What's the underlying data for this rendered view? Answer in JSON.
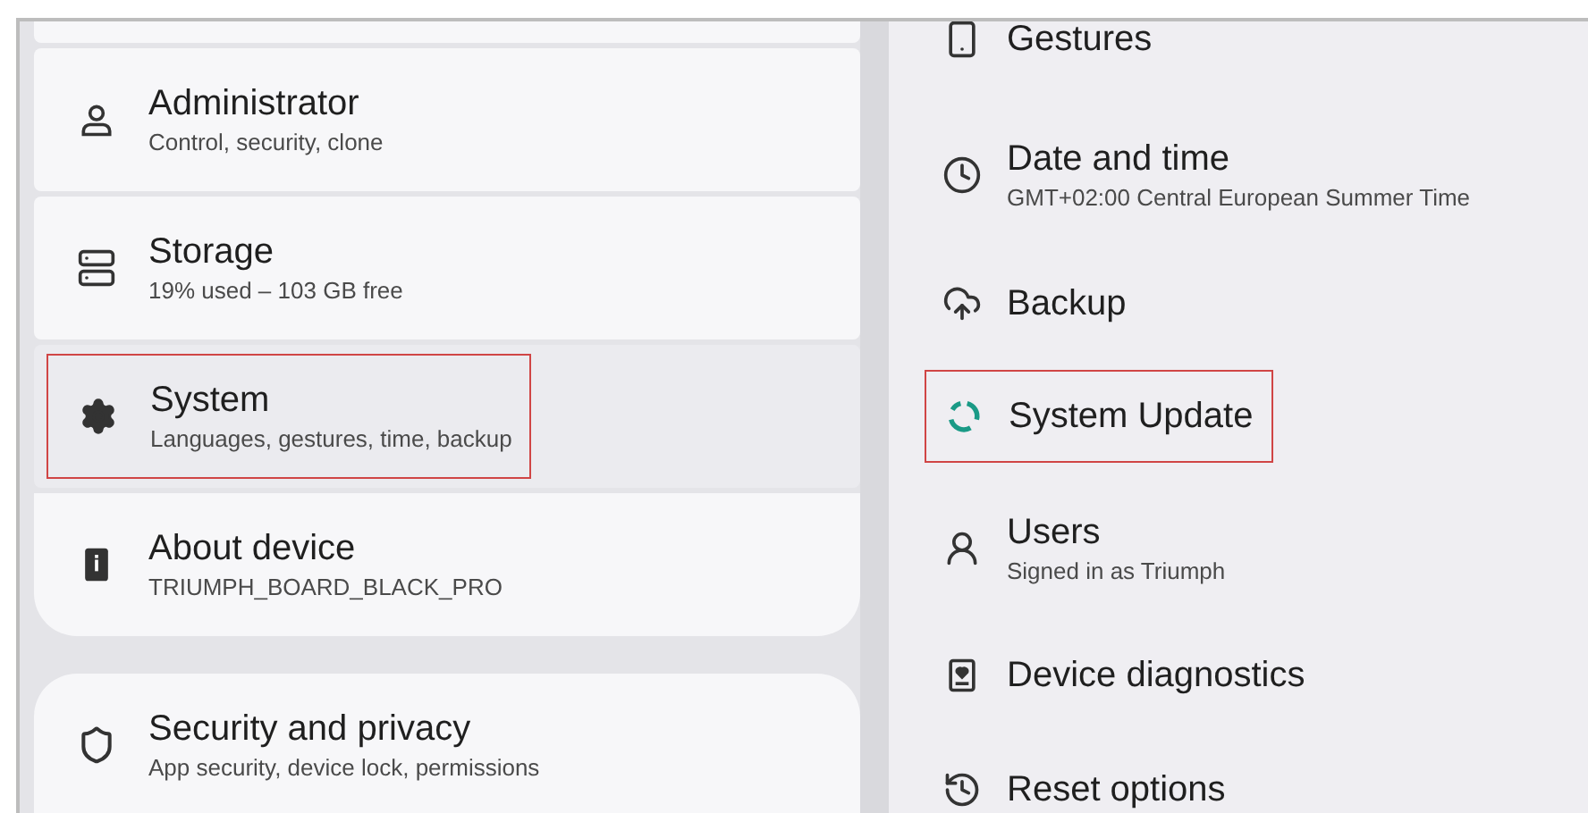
{
  "settings_list": [
    {
      "title": "Administrator",
      "subtitle": "Control, security, clone",
      "selected": false,
      "highlighted": false
    },
    {
      "title": "Storage",
      "subtitle": "19% used – 103 GB free",
      "selected": false,
      "highlighted": false
    },
    {
      "title": "System",
      "subtitle": "Languages, gestures, time, backup",
      "selected": true,
      "highlighted": true
    },
    {
      "title": "About device",
      "subtitle": "TRIUMPH_BOARD_BLACK_PRO",
      "selected": false,
      "highlighted": false
    },
    {
      "title": "Security and privacy",
      "subtitle": "App security, device lock, permissions",
      "selected": false,
      "highlighted": false
    }
  ],
  "system_pane": [
    {
      "title": "Gestures",
      "highlighted": false
    },
    {
      "title": "Date and time",
      "subtitle": "GMT+02:00 Central European Summer Time",
      "highlighted": false
    },
    {
      "title": "Backup",
      "highlighted": false
    },
    {
      "title": "System Update",
      "highlighted": true
    },
    {
      "title": "Users",
      "subtitle": "Signed in as Triumph",
      "highlighted": false
    },
    {
      "title": "Device diagnostics",
      "highlighted": false
    },
    {
      "title": "Reset options",
      "highlighted": false
    }
  ]
}
